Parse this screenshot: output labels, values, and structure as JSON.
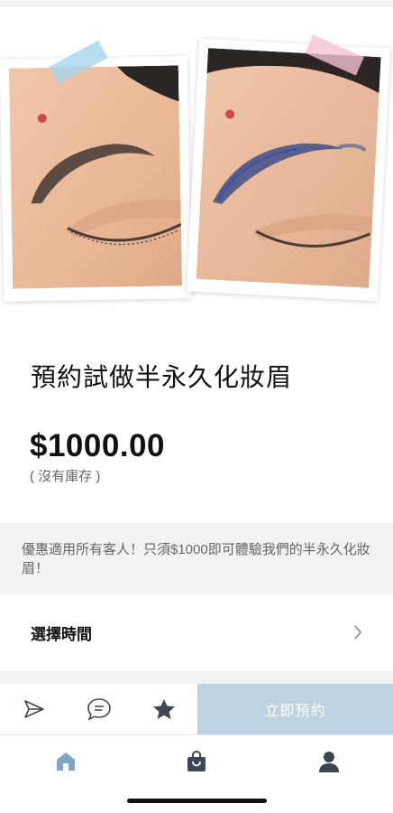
{
  "product": {
    "title": "預約試做半永久化妝眉",
    "price": "$1000.00",
    "stock_status": "( 沒有庫存 )",
    "description": "優惠適用所有客人！只須$1000即可體驗我們的半永久化妝眉！"
  },
  "gallery": {
    "images": [
      {
        "name": "before-eyebrow-photo",
        "tape_color": "#a9d3ec"
      },
      {
        "name": "after-eyebrow-sketch-photo",
        "tape_color": "#f5c2d3"
      }
    ]
  },
  "booking": {
    "select_time_label": "選擇時間",
    "book_now_label": "立即預約"
  },
  "action_bar": {
    "icons": [
      "send-icon",
      "chat-icon",
      "star-icon"
    ]
  },
  "bottom_nav": {
    "items": [
      "home-icon",
      "shopping-bag-icon",
      "profile-icon"
    ],
    "active": "home-icon"
  },
  "colors": {
    "accent": "#bcd3e2",
    "nav_active": "#7fa6c3",
    "nav_inactive": "#3d4753",
    "panel_gray": "#f2f2f2"
  }
}
